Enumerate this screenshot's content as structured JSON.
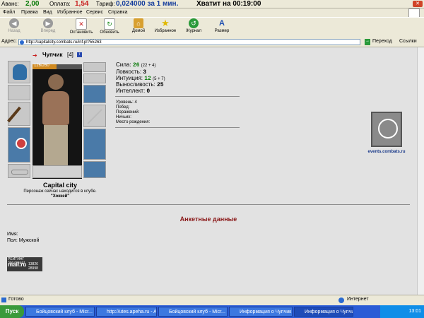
{
  "ticker": {
    "items": [
      "Аванс:",
      "2,00",
      "Оплата:",
      "1,54",
      "Тариф:",
      "0,024000 за 1 мин.",
      "Хватит на 00:19:00"
    ]
  },
  "menu": [
    "Файл",
    "Правка",
    "Вид",
    "Избранное",
    "Сервис",
    "Справка"
  ],
  "toolbar": {
    "back": "Назад",
    "forward": "Вперед",
    "stop": "Остановить",
    "refresh": "Обновить",
    "home": "Домой",
    "favorites": "Избранное",
    "history": "Журнал",
    "size": "Размер"
  },
  "address": {
    "label": "Адрес:",
    "url": "http://capitalcity.combats.ru/inf.pl?55263",
    "go": "Переход",
    "links": "Ссылки"
  },
  "character": {
    "name": "Чупчик",
    "level": "[4]",
    "hp": "126/260",
    "location_title": "Capital city",
    "location_text": "Персонаж сейчас находится в клубе.",
    "location_room": "\"Хоккей\""
  },
  "stats": {
    "strength_label": "Сила:",
    "strength_value": "26",
    "strength_extra": "(22 + 4)",
    "agility_label": "Ловкость:",
    "agility_value": "3",
    "intuition_label": "Интуиция:",
    "intuition_value": "12",
    "intuition_extra": "(5 + 7)",
    "endurance_label": "Выносливость:",
    "endurance_value": "25",
    "intellect_label": "Интеллект:",
    "intellect_value": "0"
  },
  "info": {
    "level": "Уровень: 4",
    "wins": "Побед:",
    "losses": "Поражений:",
    "draws": "Ничьих:",
    "birthplace": "Место рождения:"
  },
  "events": {
    "caption": "events.combats.ru"
  },
  "profile": {
    "title": "Анкетные данные",
    "name_label": "Имя:",
    "sex_label": "Пол: Мужской"
  },
  "counter": {
    "line1": "РЕЙТИНГ 299422491",
    "brand": "mail.ru",
    "line2": "13826",
    "line3": "28998"
  },
  "status": {
    "text": "Готово",
    "zone": "Интернет"
  },
  "taskbar": {
    "start": "Пуск",
    "tasks": [
      "Бойцовский клуб - Micr...",
      "http://utes.apeha.ru - A...",
      "Бойцовский клуб - Micr...",
      "Информация о Чупчик -...",
      "Информация о Чупчи..."
    ],
    "clock": "13:01"
  },
  "colors": {
    "accent_green": "#0a7a0a",
    "accent_red": "#c81e1e",
    "profile_title": "#8b1a1a",
    "taskbar": "#2a5cd6"
  }
}
